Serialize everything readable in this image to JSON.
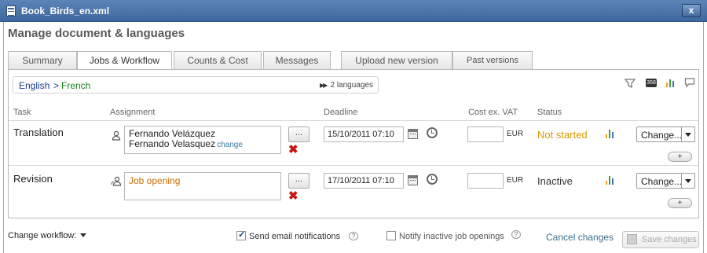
{
  "window": {
    "title": "Book_Birds_en.xml",
    "close_label": "x"
  },
  "heading": "Manage document & languages",
  "tabs": [
    {
      "label": "Summary"
    },
    {
      "label": "Jobs & Workflow"
    },
    {
      "label": "Counts & Cost"
    },
    {
      "label": "Messages"
    },
    {
      "label": "Upload new version"
    },
    {
      "label": "Past versions"
    }
  ],
  "breadcrumb": {
    "source": "English",
    "separator": ">",
    "target": "French",
    "languages": "2 languages"
  },
  "columns": {
    "task": "Task",
    "assignment": "Assignment",
    "deadline": "Deadline",
    "cost": "Cost ex. VAT",
    "status": "Status"
  },
  "rows": [
    {
      "task": "Translation",
      "assignee_1": "Fernando Velázquez",
      "assignee_2": "Fernando Velasquez",
      "change_link": "change",
      "dots": "...",
      "deadline": "15/10/2011 07:10",
      "currency": "EUR",
      "status": "Not started",
      "status_color": "#d59a00",
      "change_label": "Change...",
      "plus": "+"
    },
    {
      "task": "Revision",
      "job_opening": "Job opening",
      "dots": "...",
      "deadline": "17/10/2011 07:10",
      "currency": "EUR",
      "status": "Inactive",
      "status_color": "#333333",
      "change_label": "Change...",
      "plus": "+"
    }
  ],
  "footer": {
    "change_workflow": "Change workflow:",
    "send_email": "Send email notifications",
    "send_email_checked": true,
    "notify_inactive": "Notify inactive job openings",
    "notify_inactive_checked": false,
    "cancel": "Cancel changes",
    "save": "Save changes"
  },
  "icons": [
    "document-icon",
    "close-icon",
    "double-arrow-icon",
    "filter-icon",
    "stats-badge-icon",
    "bar-chart-icon",
    "comment-icon",
    "person-icon",
    "group-person-icon",
    "remove-icon",
    "calendar-icon",
    "alarm-icon",
    "help-icon",
    "save-icon"
  ]
}
